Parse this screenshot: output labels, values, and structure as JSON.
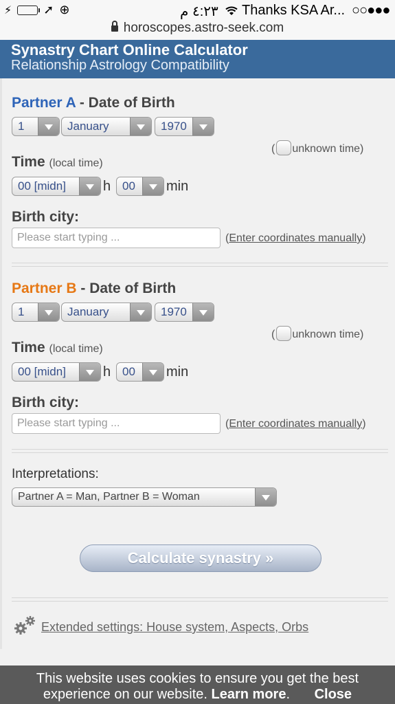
{
  "status_bar": {
    "time": "٤:٢٣ م",
    "carrier": "Thanks KSA Ar...",
    "signal": "○○●●●"
  },
  "browser": {
    "url": "horoscopes.astro-seek.com"
  },
  "header": {
    "title": "Synastry Chart Online Calculator",
    "subtitle": "Relationship Astrology Compatibility"
  },
  "partner_a": {
    "name": "Partner A",
    "dash": " - ",
    "heading": "Date of Birth",
    "day": "1",
    "month": "January",
    "year": "1970",
    "unknown_time": "unknown time)",
    "unknown_open": "(",
    "time_label": "Time",
    "time_sub": "(local time)",
    "hour": "00 [midn]",
    "hour_unit": "h",
    "minute": "00",
    "minute_unit": "min",
    "city_label": "Birth city:",
    "city_placeholder": "Please start typing ...",
    "coords_open": "(",
    "coords_link": "Enter coordinates manually",
    "coords_close": ")"
  },
  "partner_b": {
    "name": "Partner B",
    "dash": " - ",
    "heading": "Date of Birth",
    "day": "1",
    "month": "January",
    "year": "1970",
    "unknown_time": "unknown time)",
    "unknown_open": "(",
    "time_label": "Time",
    "time_sub": "(local time)",
    "hour": "00 [midn]",
    "hour_unit": "h",
    "minute": "00",
    "minute_unit": "min",
    "city_label": "Birth city:",
    "city_placeholder": "Please start typing ...",
    "coords_open": "(",
    "coords_link": "Enter coordinates manually",
    "coords_close": ")"
  },
  "interpretations": {
    "label": "Interpretations:",
    "value": "Partner A = Man, Partner B = Woman"
  },
  "calculate_button": "Calculate synastry »",
  "extended_settings": "Extended settings: House system, Aspects, Orbs",
  "cookie_banner": {
    "line1": "This website uses cookies to ensure you get the best",
    "line2": "experience on our website.",
    "learn_more": "Learn more",
    "period": ".",
    "close": "Close"
  },
  "colors": {
    "header_bg": "#3a6a9c",
    "partner_a": "#2e64b8",
    "partner_b": "#e67815",
    "button": "#a8b4c8"
  }
}
